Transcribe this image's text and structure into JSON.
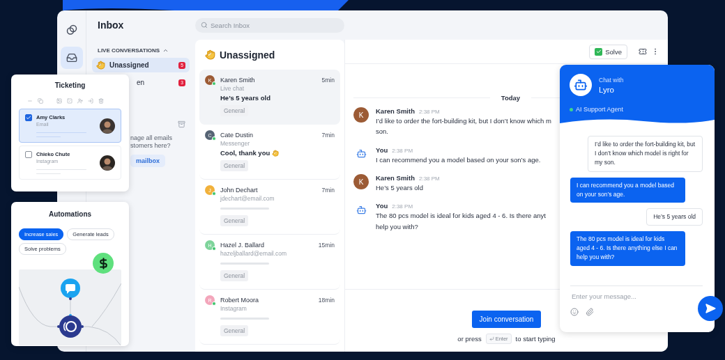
{
  "rail": {
    "items": [
      {
        "kind": "apps",
        "selected": false
      },
      {
        "kind": "inbox",
        "selected": true
      }
    ]
  },
  "inbox": {
    "title": "Inbox",
    "search": {
      "placeholder": "Search Inbox"
    }
  },
  "nav": {
    "section": "LIVE CONVERSATIONS",
    "expanded": true,
    "items": [
      {
        "label": "Unassigned",
        "hand_icon": true,
        "badge": "5",
        "selected": true
      },
      {
        "label": "en",
        "hand_icon": false,
        "badge": "3",
        "selected": false
      }
    ],
    "promo": {
      "lines": [
        "nage all emails",
        "stomers here?"
      ],
      "button": "mailbox"
    }
  },
  "list": {
    "title": "Unassigned",
    "items": [
      {
        "initial": "K",
        "color": "#9c5b35",
        "name": "Karen Smith",
        "time": "5min",
        "channel": "Live chat",
        "message": "He’s 5 years old",
        "hand_icon": false,
        "tag": "General",
        "selected": true
      },
      {
        "initial": "C",
        "color": "#566474",
        "name": "Cate Dustin",
        "time": "7min",
        "channel": "Messenger",
        "message": "Cool, thank you",
        "hand_icon": true,
        "tag": "General",
        "selected": false
      },
      {
        "initial": "J",
        "color": "#f1b13b",
        "name": "John Dechart",
        "time": "7min",
        "channel": "jdechart@email.com",
        "tag": "General",
        "selected": false
      },
      {
        "initial": "H",
        "color": "#7fd49b",
        "name": "Hazel J. Ballard",
        "time": "15min",
        "channel": "hazeljballard@email.com",
        "tag": "General",
        "selected": false
      },
      {
        "initial": "R",
        "color": "#f3a6bb",
        "name": "Robert Moora",
        "time": "18min",
        "channel": "Instagram",
        "tag": "General",
        "selected": false
      }
    ]
  },
  "chat": {
    "solve": "Solve",
    "date": "Today",
    "messages": [
      {
        "kind": "customer",
        "initial": "K",
        "author": "Karen Smith",
        "time": "2:38 PM",
        "lines": [
          "I’d like to order the fort-building kit, but I don’t know which m",
          "son."
        ]
      },
      {
        "kind": "bot",
        "author": "You",
        "time": "2:38 PM",
        "lines": [
          "I can recommend you a model based on your son’s age."
        ]
      },
      {
        "kind": "customer",
        "initial": "K",
        "author": "Karen Smith",
        "time": "2:38 PM",
        "lines": [
          "He’s 5 years old"
        ]
      },
      {
        "kind": "bot",
        "author": "You",
        "time": "2:38 PM",
        "lines": [
          "The 80 pcs model is ideal for kids aged 4 - 6. Is there anyt",
          "help you with?"
        ]
      }
    ],
    "join": "Join conversation",
    "hint_before": "or press",
    "key": "Enter",
    "hint_after": "to start typing"
  },
  "ticketing": {
    "title": "Ticketing",
    "tickets": [
      {
        "name": "Amy Clarks",
        "channel": "Email",
        "checked": true
      },
      {
        "name": "Chieko Chute",
        "channel": "Instagram",
        "checked": false
      }
    ]
  },
  "automations": {
    "title": "Automations",
    "chips": [
      {
        "label": "Increase sales",
        "selected": true
      },
      {
        "label": "Generate leads",
        "selected": false
      },
      {
        "label": "Solve problems",
        "selected": false
      }
    ]
  },
  "lyro": {
    "caption": "Chat with",
    "name": "Lyro",
    "status": "AI Support Agent",
    "online": true,
    "messages": [
      {
        "kind": "user",
        "text": "I’d like to order the fort-building kit, but I don’t know which model is right for my son."
      },
      {
        "kind": "bot",
        "text": "I can recommend you a model based on your son’s age."
      },
      {
        "kind": "user",
        "text": "He’s 5 years old"
      },
      {
        "kind": "bot",
        "text": "The 80 pcs model is ideal for kids aged 4 - 6. Is there anything else I can help you with?"
      }
    ],
    "input": {
      "placeholder": "Enter your message..."
    }
  }
}
